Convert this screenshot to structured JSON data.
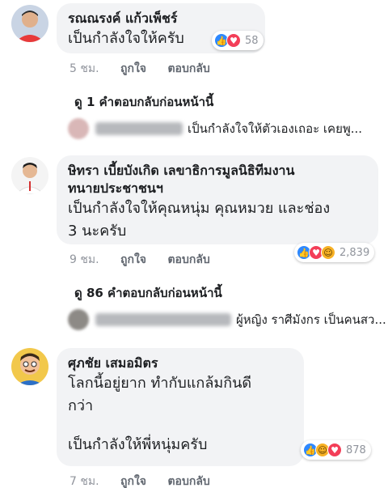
{
  "comments": [
    {
      "author": "รณณรงค์ แก้วเพ็ชร์",
      "lines": [
        "เป็นกำลังใจให้ครับ"
      ],
      "reaction_count": "58",
      "reactions": [
        "like-icon",
        "love-icon"
      ],
      "time": "5 ชม.",
      "like_label": "ถูกใจ",
      "reply_label": "ตอบกลับ"
    },
    {
      "author_lines": [
        "ษิทรา เบี้ยบังเกิด เลขาธิการมูลนิธิทีมงาน",
        "ทนายประชาชนฯ"
      ],
      "lines": [
        "เป็นกำลังใจให้คุณหนุ่ม คุณหมวย และช่อง",
        "3 นะครับ"
      ],
      "reaction_count": "2,839",
      "reactions": [
        "like-icon",
        "love-icon",
        "haha-icon"
      ],
      "time": "9 ชม.",
      "like_label": "ถูกใจ",
      "reply_label": "ตอบกลับ"
    },
    {
      "author": "ศุภชัย เสมอมิตร",
      "lines": [
        "โลกนี้อยู่ยาก  ทำกับแกล้มกินดี",
        "กว่า",
        "",
        "เป็นกำลังให้พี่หนุ่มครับ"
      ],
      "reaction_count": "878",
      "reactions": [
        "like-icon",
        "haha-icon",
        "love-icon"
      ],
      "time": "7 ชม.",
      "like_label": "ถูกใจ",
      "reply_label": "ตอบกลับ"
    }
  ],
  "previous_replies": [
    {
      "label": "ดู 1 คำตอบกลับก่อนหน้านี้",
      "preview_text": "เป็นกำลังใจให้ตัวเองเถอะ เคยพู..."
    },
    {
      "label": "ดู 86 คำตอบกลับก่อนหน้านี้",
      "preview_text": "ผู้หญิง ราศีมังกร เป็นคนสว..."
    }
  ],
  "colors": {
    "bubble": "#f2f3f5",
    "like": "#2d88ff",
    "love": "#f33e58",
    "haha": "#f7b125",
    "meta_text": "#90949c"
  }
}
